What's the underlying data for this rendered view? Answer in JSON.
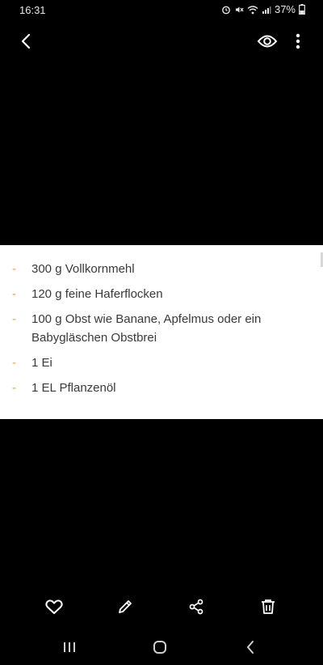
{
  "status": {
    "time": "16:31",
    "battery": "37%"
  },
  "document": {
    "ingredients": [
      "300 g Vollkornmehl",
      "120 g feine Haferflocken",
      "100 g Obst wie Banane, Apfelmus oder ein Babygläschen Obstbrei",
      "1 Ei",
      "1 EL Pflanzenöl"
    ],
    "bullet": "-"
  },
  "icons": {
    "back": "back-arrow-icon",
    "view": "eye-icon",
    "more": "more-vertical-icon",
    "favorite": "heart-icon",
    "edit": "pencil-icon",
    "share": "share-icon",
    "delete": "trash-icon",
    "recents": "recents-icon",
    "home": "home-icon",
    "nav_back": "nav-back-icon"
  },
  "colors": {
    "background": "#000000",
    "document_bg": "#ffffff",
    "text": "#3a3a3a",
    "bullet": "#e3a446",
    "icon": "#ffffff"
  }
}
